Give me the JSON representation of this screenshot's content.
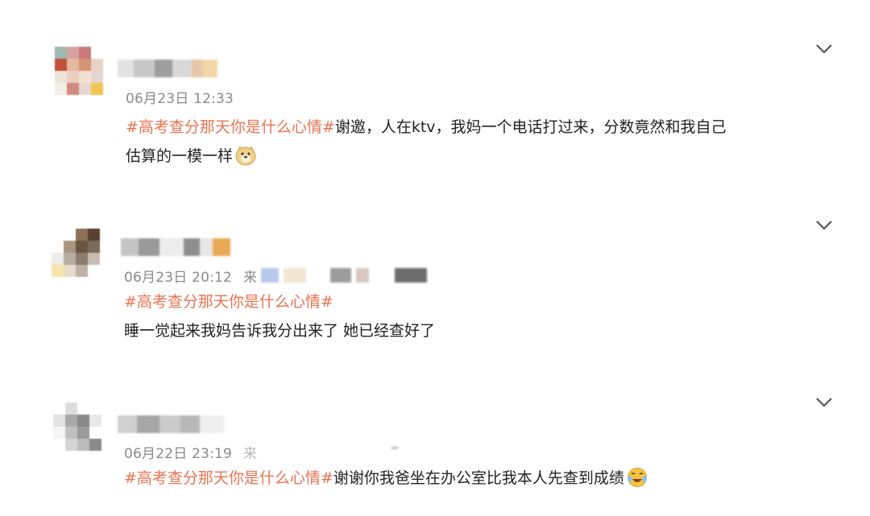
{
  "comments": [
    {
      "time": "06月23日 12:33",
      "source_prefix": "",
      "topic": "#高考查分那天你是什么心情#",
      "text_line1": "谢邀，人在ktv，我妈一个电话打过来，分数竟然和我自己",
      "text_line2": "估算的一模一样",
      "emoji": "doge-emoji"
    },
    {
      "time": "06月23日 20:12",
      "source_prefix": "来",
      "topic": "#高考查分那天你是什么心情#",
      "text_line1": "睡一觉起来我妈告诉我分出来了 她已经查好了",
      "emoji": ""
    },
    {
      "time": "06月22日 23:19",
      "source_prefix": "来",
      "topic": "#高考查分那天你是什么心情#",
      "text_line1": "谢谢你我爸坐在办公室比我本人先查到成绩",
      "emoji": "crying-laugh-emoji"
    }
  ],
  "colors": {
    "topic": "#eb7350",
    "time": "#8a8a8a",
    "text": "#222222"
  },
  "icons": {
    "expand": "chevron-down-icon"
  }
}
